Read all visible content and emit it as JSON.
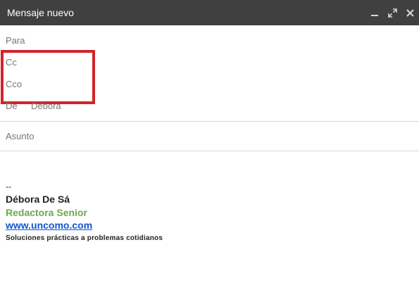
{
  "window": {
    "title": "Mensaje nuevo",
    "controls": {
      "minimize": "minimize-icon",
      "expand": "expand-icon",
      "close": "close-icon"
    }
  },
  "fields": {
    "para_label": "Para",
    "cc_label": "Cc",
    "cco_label": "Cco",
    "de_label": "De",
    "de_value": "Débora",
    "asunto_placeholder": "Asunto"
  },
  "signature": {
    "separator": "--",
    "name": "Débora De Sá",
    "role": "Redactora Senior",
    "website": "www.uncomo.com",
    "tagline": "Soluciones prácticas a problemas cotidianos"
  },
  "colors": {
    "titlebar": "#404040",
    "highlight_box": "#d2232a",
    "role_green": "#6aa84f",
    "link_blue": "#1155cc",
    "label_gray": "#777777"
  }
}
